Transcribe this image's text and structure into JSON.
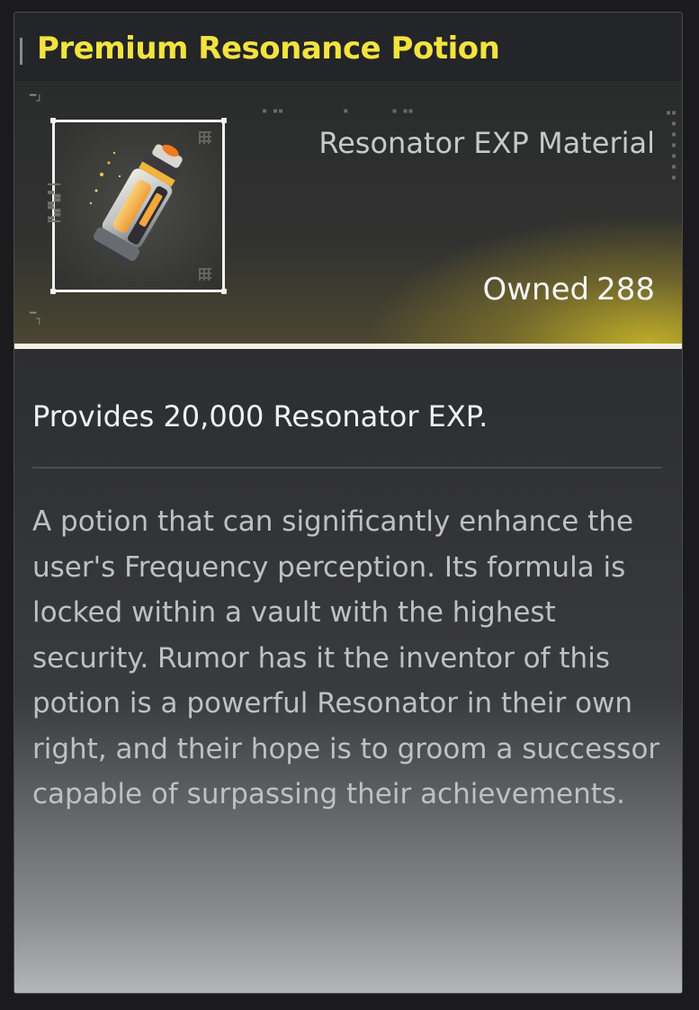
{
  "item": {
    "title": "Premium Resonance Potion",
    "category": "Resonator EXP Material",
    "owned_label": "Owned",
    "owned_count": "288",
    "icon": "potion-canister-icon",
    "effect": "Provides 20,000 Resonator EXP.",
    "description": "A potion that can significantly enhance the user's Frequency perception. Its formula is locked within a vault with the highest security. Rumor has it the inventor of this potion is a powerful Resonator in their own right, and their hope is to groom a successor capable of surpassing their achievements."
  },
  "colors": {
    "title": "#f3e33f",
    "accent_glow": "#d2be28",
    "header_line": "#f4f1e4"
  }
}
